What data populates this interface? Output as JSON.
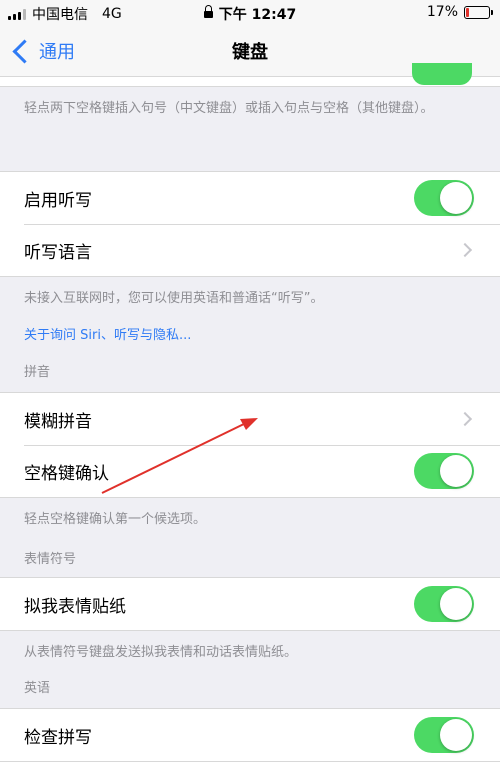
{
  "status_bar": {
    "carrier": "中国电信",
    "network": "4G",
    "time": "下午 12:47",
    "battery": "17%",
    "battery_level": 0.17,
    "battery_color": "#e0312b"
  },
  "nav": {
    "back_label": "通用",
    "title": "键盘",
    "accent_color": "#2f7bf5"
  },
  "text": {
    "period_footer": "轻点两下空格键插入句号（中文键盘）或插入句点与空格（其他键盘）。",
    "dictation_footer": "未接入互联网时，您可以使用英语和普通话“听写”。",
    "siri_link": "关于询问 Siri、听写与隐私...",
    "pinyin_header": "拼音",
    "space_footer": "轻点空格键确认第一个候选项。",
    "emoji_header": "表情符号",
    "memoji_footer": "从表情符号键盘发送拟我表情和动话表情贴纸。",
    "english_header": "英语"
  },
  "cells": {
    "enable_dictation": {
      "label": "启用听写",
      "on": true
    },
    "dictation_language": {
      "label": "听写语言"
    },
    "fuzzy_pinyin": {
      "label": "模糊拼音"
    },
    "space_confirm": {
      "label": "空格键确认",
      "on": true
    },
    "memoji_stickers": {
      "label": "拟我表情贴纸",
      "on": true
    },
    "check_spelling": {
      "label": "检查拼写",
      "on": true
    }
  },
  "colors": {
    "toggle_on": "#4cd964",
    "annotation_arrow": "#e0312b"
  }
}
